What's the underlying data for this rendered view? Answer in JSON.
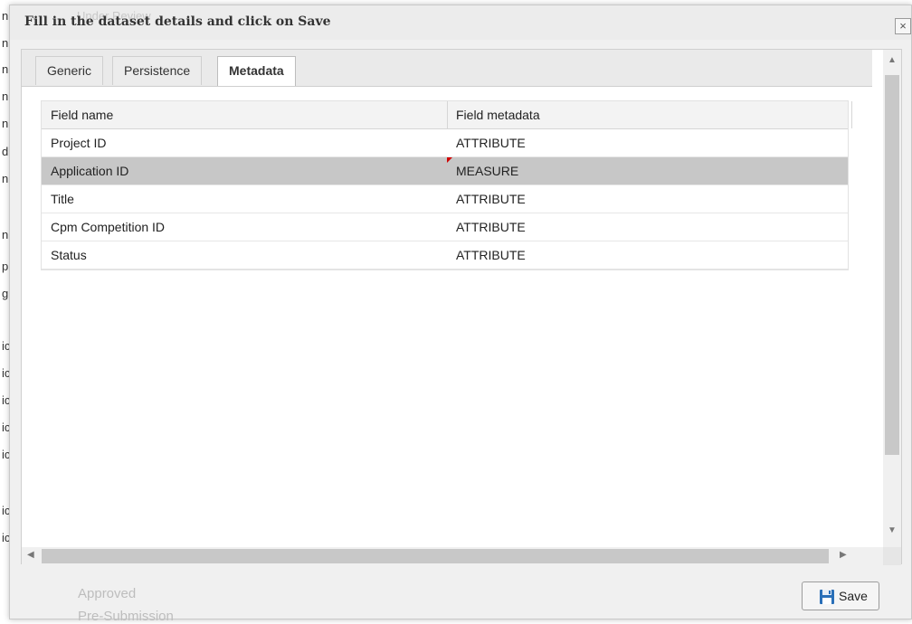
{
  "background": {
    "fragments": [
      "n",
      "n",
      "n",
      "n",
      "n",
      "d",
      "n",
      "n",
      "p",
      "g",
      "ic",
      "ic",
      "ic",
      "ic",
      "ic",
      "ic",
      "ic"
    ],
    "under_review": "Under Review",
    "approved": "Approved",
    "pre_submission": "Pre-Submission"
  },
  "dialog": {
    "title": "Fill in the dataset details and click on Save",
    "close_icon": "×"
  },
  "tabs": [
    {
      "label": "Generic",
      "active": false
    },
    {
      "label": "Persistence",
      "active": false
    },
    {
      "label": "Metadata",
      "active": true
    }
  ],
  "grid": {
    "columns": [
      "Field name",
      "Field metadata"
    ],
    "rows": [
      {
        "field": "Project ID",
        "metadata": "ATTRIBUTE",
        "selected": false
      },
      {
        "field": "Application ID",
        "metadata": "MEASURE",
        "selected": true,
        "dirty": true
      },
      {
        "field": "Title",
        "metadata": "ATTRIBUTE",
        "selected": false
      },
      {
        "field": "Cpm Competition ID",
        "metadata": "ATTRIBUTE",
        "selected": false
      },
      {
        "field": "Status",
        "metadata": "ATTRIBUTE",
        "selected": false
      }
    ]
  },
  "footer": {
    "save_label": "Save",
    "save_icon": "floppy-disk-icon"
  },
  "colors": {
    "selected_row": "#c7c7c7",
    "dirty_marker": "#d00000",
    "save_icon": "#2a6fb8"
  }
}
